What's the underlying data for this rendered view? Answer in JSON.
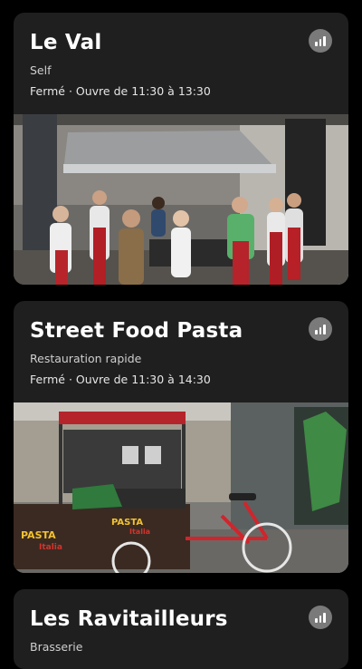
{
  "restaurants": [
    {
      "name": "Le Val",
      "category": "Self",
      "hours": "Fermé · Ouvre de 11:30 à 13:30",
      "stats_icon": "bar-chart-icon",
      "photo": "photo-cooking-class-kitchen"
    },
    {
      "name": "Street Food Pasta",
      "category": "Restauration rapide",
      "hours": "Fermé · Ouvre de 11:30 à 14:30",
      "stats_icon": "bar-chart-icon",
      "photo": "photo-pasta-cart-bicycle",
      "photo_sign_text": [
        "PASTA",
        "Italia"
      ]
    },
    {
      "name": "Les Ravitailleurs",
      "category": "Brasserie",
      "stats_icon": "bar-chart-icon"
    }
  ],
  "colors": {
    "background": "#000000",
    "card": "#1f1f1f",
    "icon_circle": "#7a7a7a"
  }
}
